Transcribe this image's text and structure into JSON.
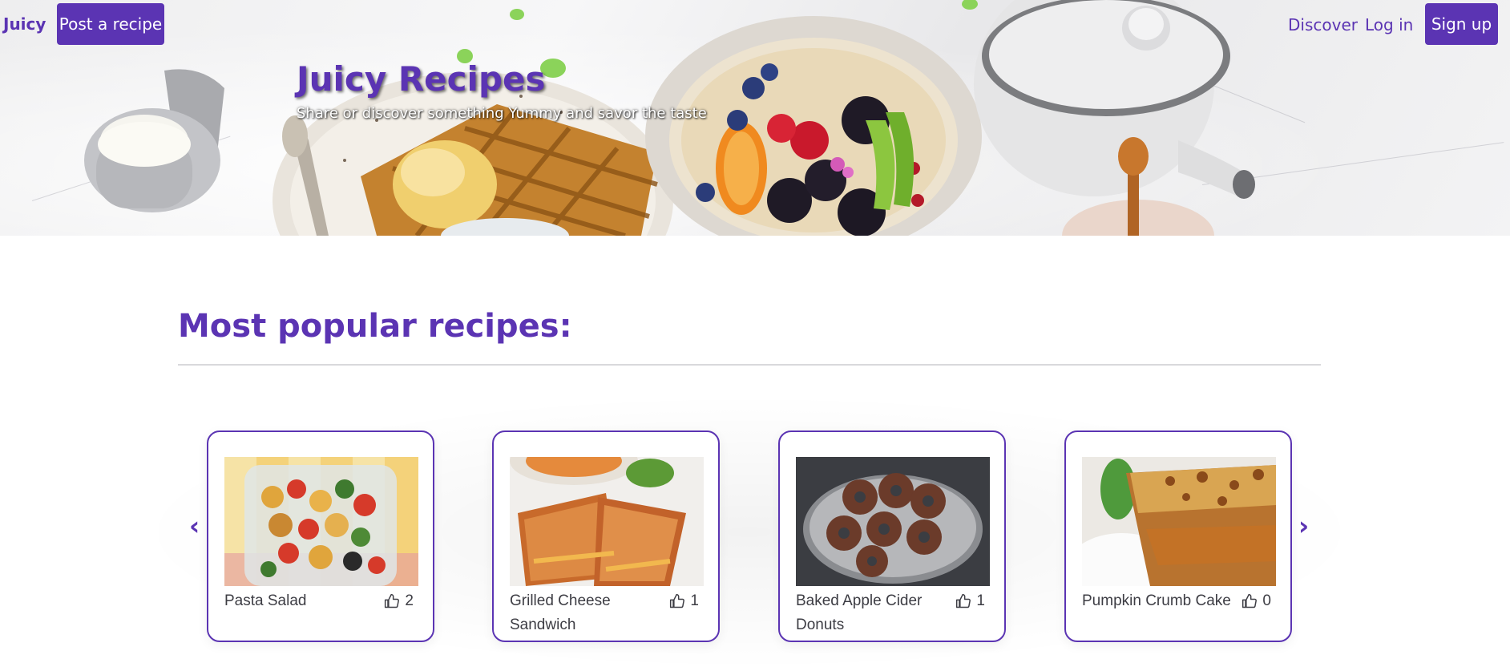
{
  "navbar": {
    "brand": "Juicy",
    "post_button": "Post a recipe",
    "discover_link": "Discover",
    "login_link": "Log in",
    "signup_button": "Sign up"
  },
  "hero": {
    "title": "Juicy Recipes",
    "subtitle": "Share or discover something Yummy and savor the taste"
  },
  "popular": {
    "heading": "Most popular recipes:",
    "prev_arrow": "‹",
    "next_arrow": "›",
    "recipes": [
      {
        "name": "Pasta Salad",
        "likes": "2",
        "image": "pasta-salad-photo"
      },
      {
        "name": "Grilled Cheese Sandwich",
        "likes": "1",
        "image": "grilled-cheese-photo"
      },
      {
        "name": "Baked Apple Cider Donuts",
        "likes": "1",
        "image": "donuts-photo"
      },
      {
        "name": "Pumpkin Crumb Cake",
        "likes": "0",
        "image": "pumpkin-cake-photo"
      }
    ]
  },
  "colors": {
    "accent": "#5b34b3",
    "text": "#3d3d44",
    "divider": "#d9d9dc"
  },
  "icons": {
    "likes": "thumbs-up-icon",
    "prev": "chevron-left-icon",
    "next": "chevron-right-icon"
  }
}
